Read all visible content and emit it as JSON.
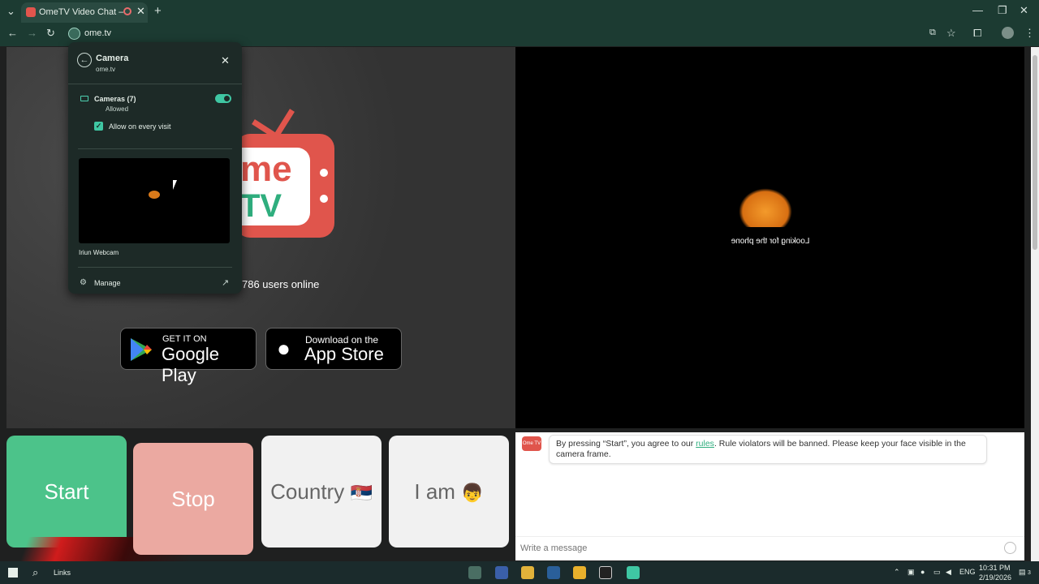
{
  "browser": {
    "tab_title": "OmeTV Video Chat — Ome",
    "tab_close": "✕",
    "new_tab": "+",
    "url": "ome.tv",
    "window_controls": {
      "minimize": "—",
      "restore": "❐",
      "close": "✕"
    },
    "nav": {
      "back": "←",
      "forward": "→",
      "reload": "↻"
    },
    "toolbar_icons": [
      "install-icon",
      "star-icon",
      "extensions-icon",
      "profile-icon",
      "menu-icon"
    ]
  },
  "popup": {
    "back": "←",
    "title": "Camera",
    "site": "ome.tv",
    "close": "✕",
    "permission_label": "Cameras (7)",
    "permission_status": "Allowed",
    "toggle_on": true,
    "allow_every_visit": "Allow on every visit",
    "checked": "✓",
    "camera_name": "Iriun Webcam",
    "manage": "Manage"
  },
  "page": {
    "logo_me": "me",
    "logo_tv": "TV",
    "users_online": "786 users online",
    "google_play": {
      "small": "GET IT ON",
      "big": "Google Play"
    },
    "app_store": {
      "small": "Download on the",
      "big": "App Store"
    },
    "remote_video_text": "Looking for the phone"
  },
  "controls": {
    "start": "Start",
    "stop": "Stop",
    "country": "Country",
    "country_flag": "🇷🇸",
    "i_am": "I am",
    "i_am_emoji": "👦"
  },
  "chat": {
    "logo_text": "Ome TV",
    "message_before": "By pressing “Start”, you agree to our ",
    "message_link": "rules",
    "message_after": ". Rule violators will be banned. Please keep your face visible in the camera frame.",
    "input_placeholder": "Write a message"
  },
  "taskbar": {
    "search_label": "Links",
    "language": "ENG",
    "time": "10:31 PM",
    "date": "2/19/2026",
    "notifications": "3"
  }
}
